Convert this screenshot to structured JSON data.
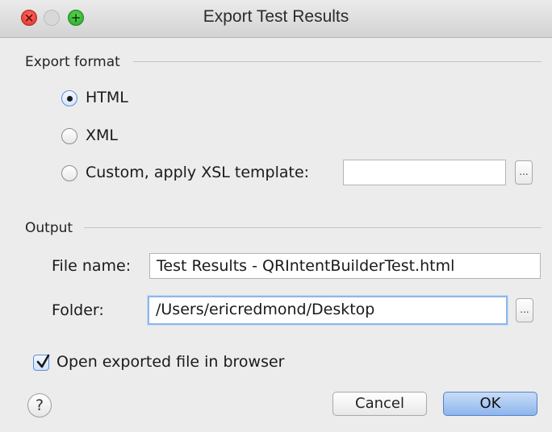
{
  "window": {
    "title": "Export Test Results",
    "controls": {
      "close_glyph": "×",
      "zoom_glyph": "+"
    }
  },
  "export_format": {
    "section_title": "Export format",
    "options": [
      {
        "label": "HTML",
        "selected": true
      },
      {
        "label": "XML",
        "selected": false
      },
      {
        "label": "Custom, apply XSL template:",
        "selected": false
      }
    ],
    "xsl_template_value": "",
    "browse_label": "..."
  },
  "output": {
    "section_title": "Output",
    "file_name_label": "File name:",
    "file_name_value": "Test Results - QRIntentBuilderTest.html",
    "folder_label": "Folder:",
    "folder_value": "/Users/ericredmond/Desktop",
    "browse_label": "..."
  },
  "open_in_browser": {
    "label": "Open exported file in browser",
    "checked": true
  },
  "footer": {
    "help_label": "?",
    "cancel_label": "Cancel",
    "ok_label": "OK"
  },
  "colors": {
    "accent": "#5b8fd6",
    "ok_button": "#8eb6ee",
    "window_bg": "#ececec"
  }
}
